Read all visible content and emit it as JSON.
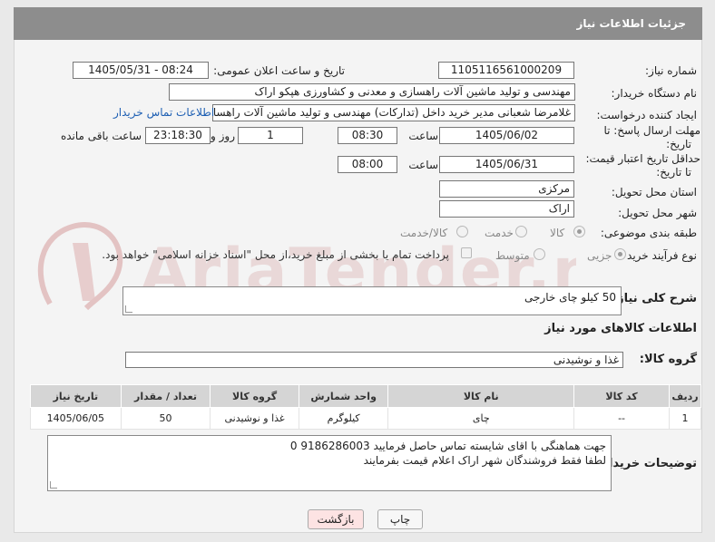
{
  "header": {
    "title": "جزئیات اطلاعات نیاز"
  },
  "fields": {
    "need_number_label": "شماره نیاز:",
    "need_number": "1105116561000209",
    "announce_label": "تاریخ و ساعت اعلان عمومی:",
    "announce_value": "1405/05/31 - 08:24",
    "buyer_label": "نام دستگاه خریدار:",
    "buyer_value": "مهندسی و تولید ماشین آلات راهسازی و معدنی و کشاورزی هپکو اراک",
    "creator_label": "ایجاد کننده درخواست:",
    "creator_value": "غلامرضا شعبانی مدیر خرید داخل (تدارکات) مهندسی و تولید ماشین آلات راهسا",
    "buyer_contact_link": "اطلاعات تماس خریدار",
    "deadline_label_1": "مهلت ارسال پاسخ: تا",
    "deadline_label_2": "تاریخ:",
    "deadline_date": "1405/06/02",
    "time_label": "ساعت",
    "deadline_time": "08:30",
    "days_value": "1",
    "days_label": "روز و",
    "remaining_time": "23:18:30",
    "remaining_label": "ساعت باقی مانده",
    "price_deadline_label_1": "حداقل تاریخ اعتبار قیمت:",
    "price_deadline_label_2": "تا تاریخ:",
    "price_date": "1405/06/31",
    "price_time": "08:00",
    "province_label": "استان محل تحویل:",
    "province_value": "مرکزی",
    "city_label": "شهر محل تحویل:",
    "city_value": "اراک",
    "category_label": "طبقه بندی موضوعی:",
    "category_options": [
      "کالا",
      "خدمت",
      "کالا/خدمت"
    ],
    "process_label": "نوع فرآیند خرید :",
    "process_options": [
      "جزیی",
      "متوسط"
    ],
    "payment_note": "پرداخت تمام یا بخشی از مبلغ خرید،از محل \"اسناد خزانه اسلامی\" خواهد بود."
  },
  "description": {
    "label": "شرح کلی نیاز:",
    "value": "50 کیلو چای خارجی"
  },
  "goods_section_title": "اطلاعات کالاهای مورد نیاز",
  "goods_group": {
    "label": "گروه کالا:",
    "value": "غذا و نوشیدنی"
  },
  "table": {
    "headers": [
      "ردیف",
      "کد کالا",
      "نام کالا",
      "واحد شمارش",
      "گروه کالا",
      "تعداد / مقدار",
      "تاریخ نیاز"
    ],
    "rows": [
      [
        "1",
        "--",
        "چای",
        "کیلوگرم",
        "غذا و نوشیدنی",
        "50",
        "1405/06/05"
      ]
    ]
  },
  "buyer_notes": {
    "label": "توضیحات خریدار:",
    "line1": "جهت هماهنگی با  اقای شایسته تماس حاصل فرمایید 9186286003 0",
    "line2": "لطفا فقط فروشندگان شهر اراک اعلام قیمت بفرمایند"
  },
  "buttons": {
    "print": "چاپ",
    "back": "بازگشت"
  },
  "watermark": {
    "text": "AriaTender.neT"
  },
  "colors": {
    "header_bg": "#8d8d8d",
    "link": "#1e5fb3",
    "back_btn": "#fde3e3"
  }
}
